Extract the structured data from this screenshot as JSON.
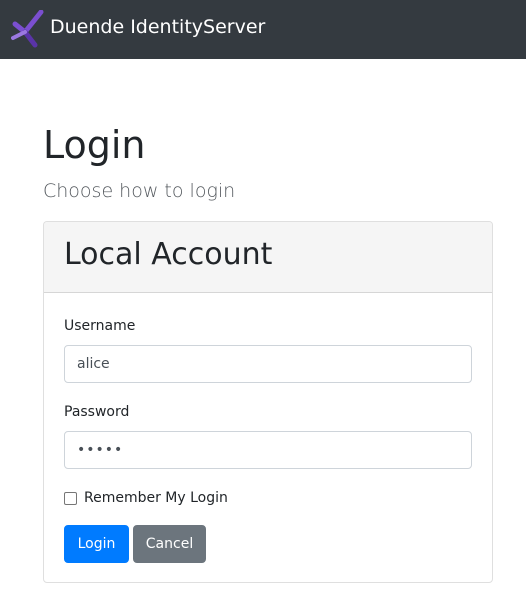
{
  "navbar": {
    "brand_name": "Duende IdentityServer",
    "logo_icon": "duende-logo-icon",
    "logo_colors": [
      "#6f42c1",
      "#8a63d2"
    ]
  },
  "page": {
    "title": "Login",
    "subtitle": "Choose how to login"
  },
  "local_account": {
    "title": "Local Account",
    "username_label": "Username",
    "username_value": "alice",
    "password_label": "Password",
    "password_value": "•••••",
    "remember_label": "Remember My Login",
    "remember_checked": false,
    "login_button": "Login",
    "cancel_button": "Cancel"
  },
  "colors": {
    "navbar_bg": "#343a40",
    "primary": "#007bff",
    "secondary": "#6c757d"
  }
}
